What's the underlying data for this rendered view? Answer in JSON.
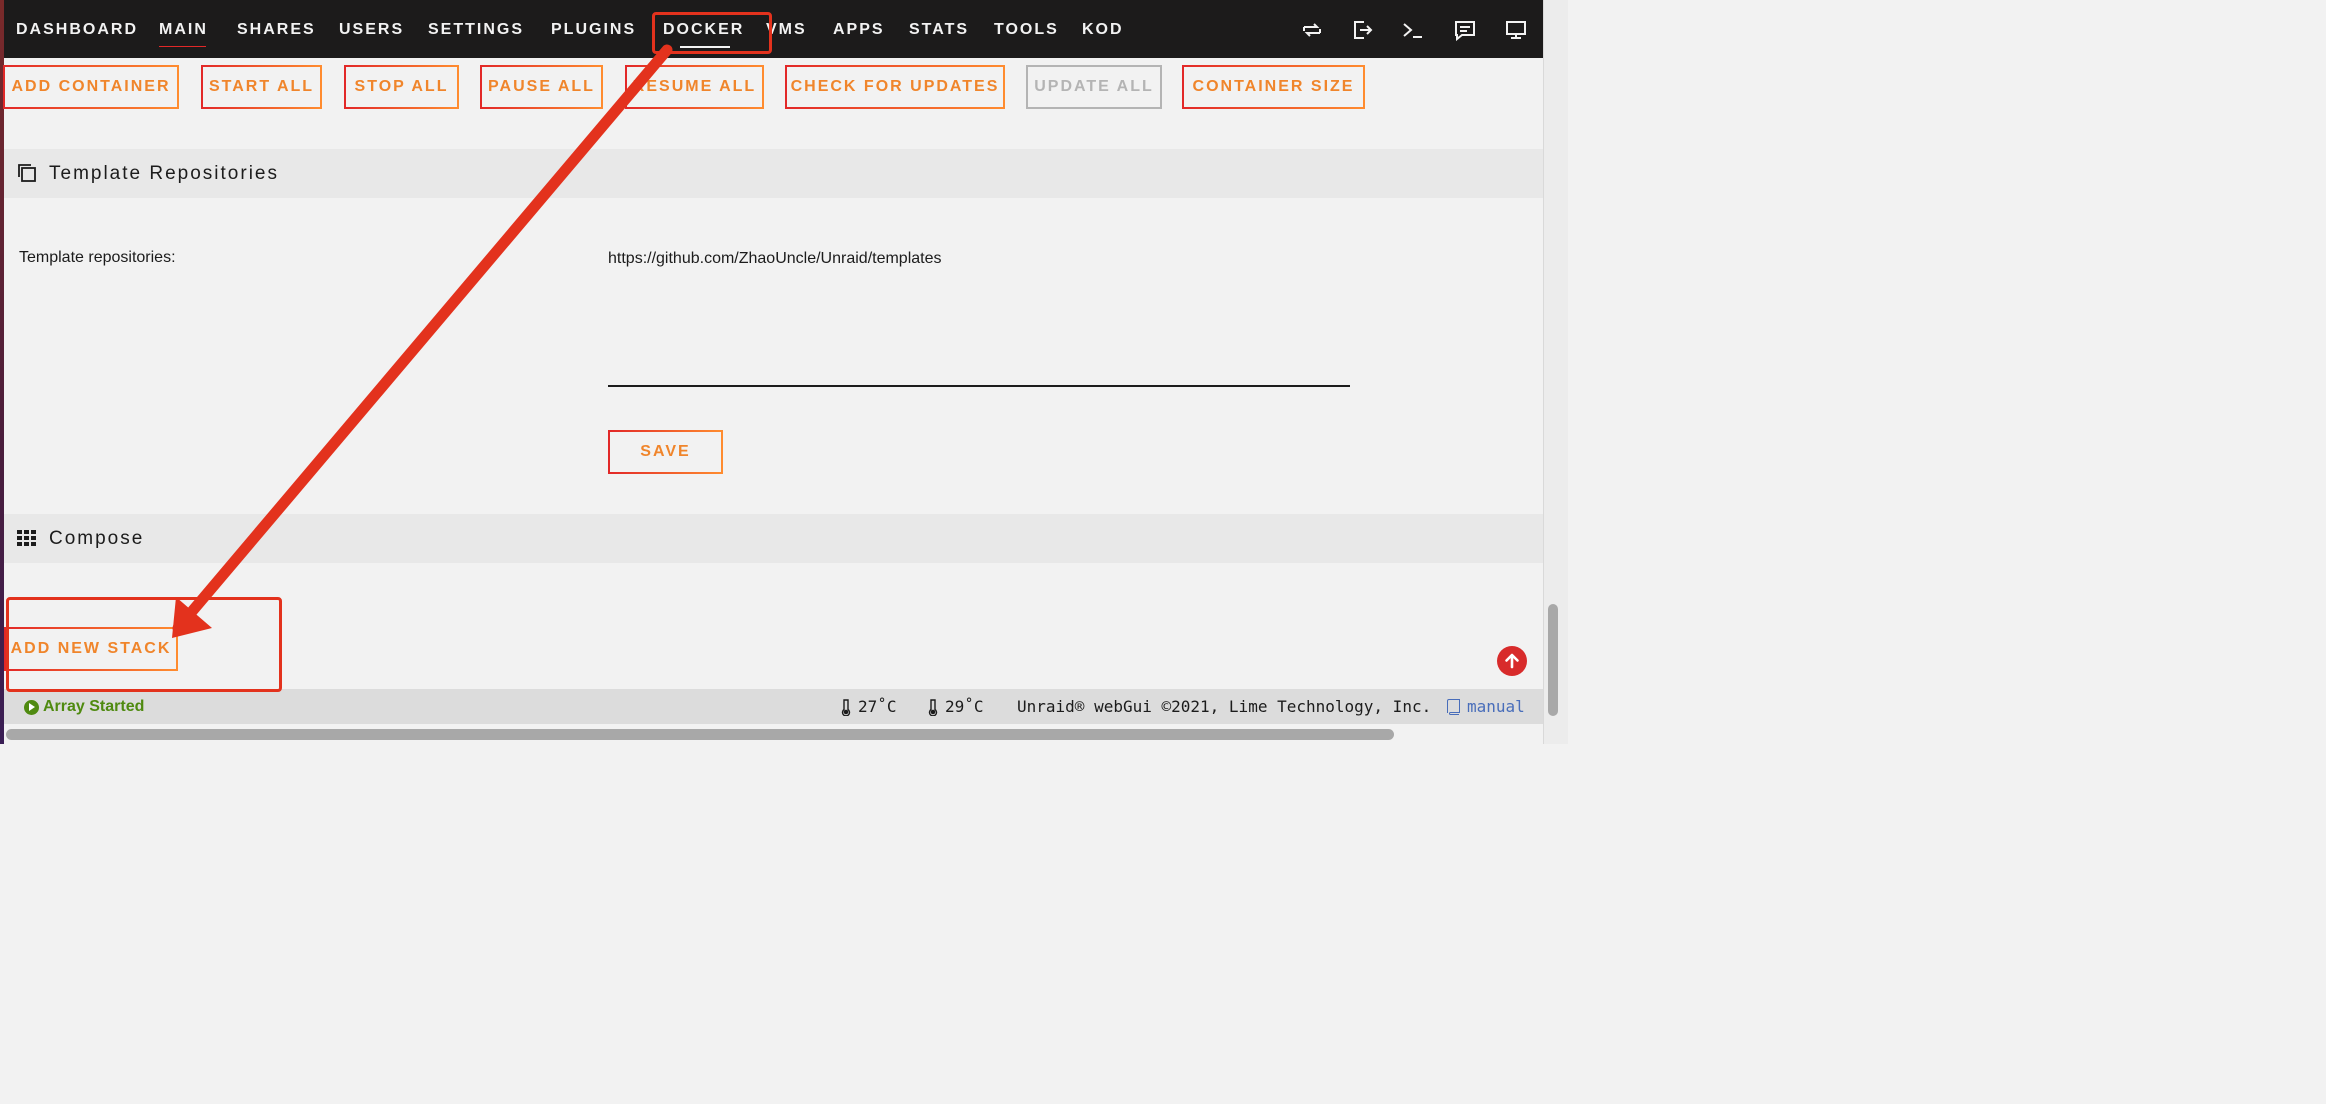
{
  "nav": {
    "tabs": [
      "DASHBOARD",
      "MAIN",
      "SHARES",
      "USERS",
      "SETTINGS",
      "PLUGINS",
      "DOCKER",
      "VMS",
      "APPS",
      "STATS",
      "TOOLS",
      "KOD"
    ],
    "active_tab": "DOCKER",
    "right_icons": [
      "refresh-icon",
      "logout-icon",
      "terminal-icon",
      "feedback-icon",
      "monitor-icon"
    ]
  },
  "actions": {
    "add_container": "ADD CONTAINER",
    "start_all": "START ALL",
    "stop_all": "STOP ALL",
    "pause_all": "PAUSE ALL",
    "resume_all": "RESUME ALL",
    "check_updates": "CHECK FOR UPDATES",
    "update_all": "UPDATE ALL",
    "container_size": "CONTAINER SIZE"
  },
  "template_repos": {
    "section_title": "Template Repositories",
    "label": "Template repositories:",
    "value": "https://github.com/ZhaoUncle/Unraid/templates",
    "save_label": "SAVE"
  },
  "compose": {
    "section_title": "Compose",
    "add_stack_label": "ADD NEW STACK"
  },
  "footer": {
    "status": "Array Started",
    "temp_1": "27˚C",
    "temp_2": "29˚C",
    "copyright": "Unraid® webGui ©2021, Lime Technology, Inc.",
    "manual": "manual"
  },
  "colors": {
    "accent_orange": "#f0852b",
    "accent_red": "#e22828",
    "annotation_red": "#e3321d",
    "status_green": "#4f8a10",
    "link_blue": "#486dba"
  }
}
